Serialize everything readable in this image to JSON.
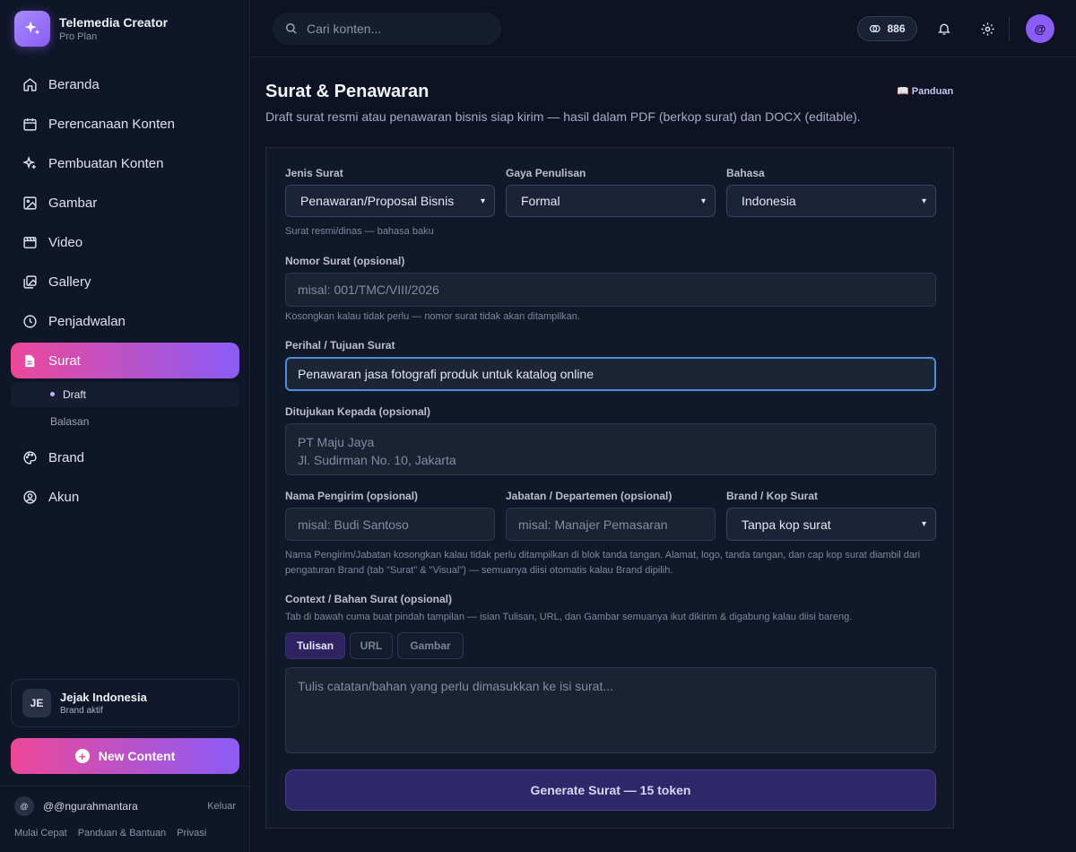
{
  "app": {
    "title": "Telemedia Creator",
    "plan": "Pro Plan"
  },
  "nav": {
    "items": [
      {
        "label": "Beranda",
        "icon": "home-icon"
      },
      {
        "label": "Perencanaan Konten",
        "icon": "calendar-icon"
      },
      {
        "label": "Pembuatan Konten",
        "icon": "sparkles-icon"
      },
      {
        "label": "Gambar",
        "icon": "image-icon"
      },
      {
        "label": "Video",
        "icon": "clapperboard-icon"
      },
      {
        "label": "Gallery",
        "icon": "gallery-icon"
      },
      {
        "label": "Penjadwalan",
        "icon": "clock-icon"
      },
      {
        "label": "Surat",
        "icon": "document-icon"
      },
      {
        "label": "Brand",
        "icon": "palette-icon"
      },
      {
        "label": "Akun",
        "icon": "user-circle-icon"
      }
    ],
    "active": "Surat",
    "sub_items": [
      {
        "label": "Draft"
      },
      {
        "label": "Balasan"
      }
    ],
    "active_sub": "Draft"
  },
  "brand_card": {
    "initials": "JE",
    "name": "Jejak Indonesia",
    "status": "Brand aktif"
  },
  "new_content_label": "New Content",
  "user": {
    "avatar": "@",
    "handle": "@@ngurahmantara",
    "logout": "Keluar"
  },
  "footer_links": [
    "Mulai Cepat",
    "Panduan & Bantuan",
    "Privasi"
  ],
  "topbar": {
    "search_placeholder": "Cari konten...",
    "tokens": "886",
    "avatar": "@"
  },
  "page": {
    "title": "Surat & Penawaran",
    "guide": "📖 Panduan",
    "description": "Draft surat resmi atau penawaran bisnis siap kirim — hasil dalam PDF (berkop surat) dan DOCX (editable)."
  },
  "form": {
    "jenis": {
      "label": "Jenis Surat",
      "value": "Penawaran/Proposal Bisnis",
      "help": "Surat resmi/dinas — bahasa baku"
    },
    "gaya": {
      "label": "Gaya Penulisan",
      "value": "Formal"
    },
    "bahasa": {
      "label": "Bahasa",
      "value": "Indonesia"
    },
    "nomor": {
      "label": "Nomor Surat (opsional)",
      "placeholder": "misal: 001/TMC/VIII/2026",
      "help": "Kosongkan kalau tidak perlu — nomor surat tidak akan ditampilkan."
    },
    "perihal": {
      "label": "Perihal / Tujuan Surat",
      "value": "Penawaran jasa fotografi produk untuk katalog online"
    },
    "ditujukan": {
      "label": "Ditujukan Kepada (opsional)",
      "placeholder": "PT Maju Jaya\nJl. Sudirman No. 10, Jakarta"
    },
    "pengirim": {
      "label": "Nama Pengirim (opsional)",
      "placeholder": "misal: Budi Santoso"
    },
    "jabatan": {
      "label": "Jabatan / Departemen (opsional)",
      "placeholder": "misal: Manajer Pemasaran"
    },
    "kop": {
      "label": "Brand / Kop Surat",
      "value": "Tanpa kop surat"
    },
    "sender_help": "Nama Pengirim/Jabatan kosongkan kalau tidak perlu ditampilkan di blok tanda tangan. Alamat, logo, tanda tangan, dan cap kop surat diambil dari pengaturan Brand (tab \"Surat\" & \"Visual\") — semuanya diisi otomatis kalau Brand dipilih.",
    "context": {
      "label": "Context / Bahan Surat (opsional)",
      "help": "Tab di bawah cuma buat pindah tampilan — isian Tulisan, URL, dan Gambar semuanya ikut dikirim & digabung kalau diisi bareng.",
      "tabs": [
        "Tulisan",
        "URL",
        "Gambar"
      ],
      "active_tab": "Tulisan",
      "placeholder": "Tulis catatan/bahan yang perlu dimasukkan ke isi surat..."
    },
    "generate_label": "Generate Surat — 15 token"
  },
  "colors": {
    "accent_from": "#ec4899",
    "accent_to": "#8b5cf6",
    "bg": "#0d1322",
    "focus": "#4b8fd8"
  }
}
